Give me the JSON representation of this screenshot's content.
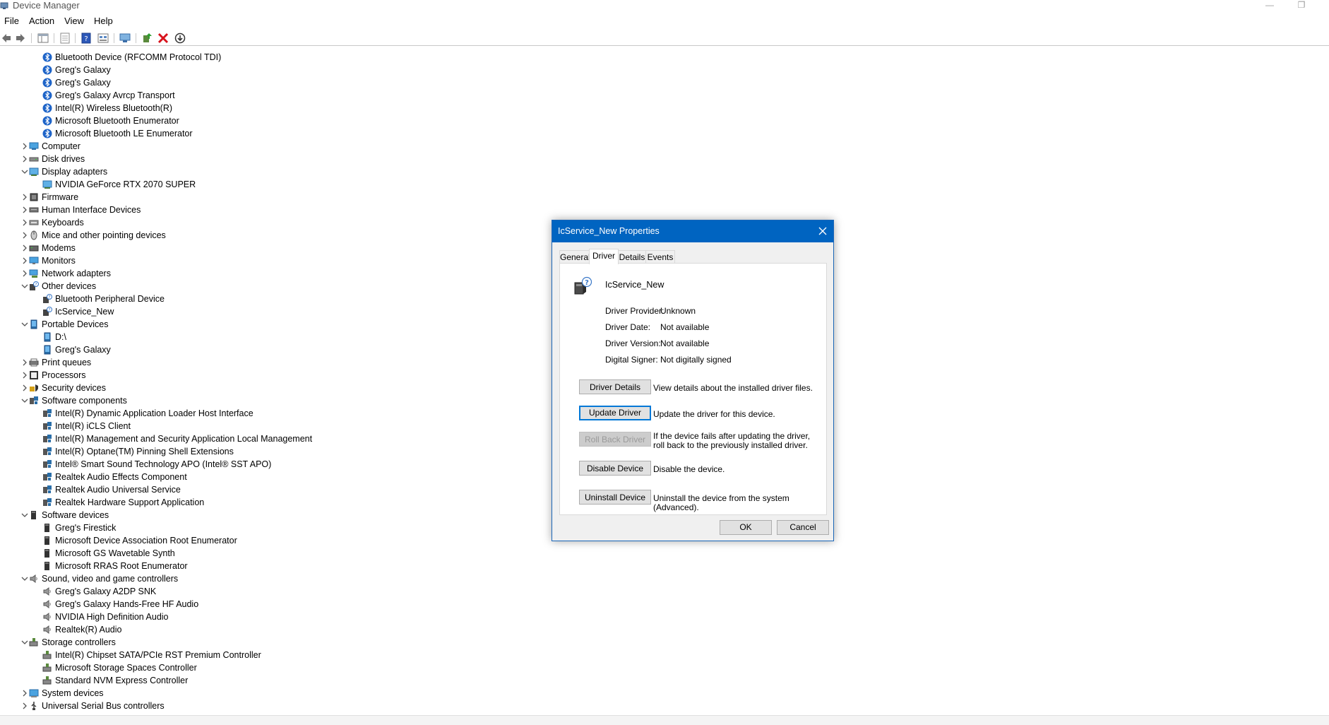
{
  "window": {
    "title": "Device Manager"
  },
  "menu": [
    "File",
    "Action",
    "View",
    "Help"
  ],
  "toolbar": {
    "buttons": [
      "back-arrow-icon",
      "forward-arrow-icon",
      "show-hide-console-tree-icon",
      "properties-icon",
      "help-icon",
      "resource-view-icon",
      "scan-hardware-icon",
      "update-driver-icon",
      "uninstall-device-icon",
      "disable-device-icon"
    ]
  },
  "tree": [
    {
      "label": "Bluetooth Device (RFCOMM Protocol TDI)",
      "level": 1,
      "icon": "bluetooth-icon"
    },
    {
      "label": "Greg's Galaxy",
      "level": 1,
      "icon": "bluetooth-icon"
    },
    {
      "label": "Greg's Galaxy",
      "level": 1,
      "icon": "bluetooth-icon"
    },
    {
      "label": "Greg's Galaxy Avrcp Transport",
      "level": 1,
      "icon": "bluetooth-icon"
    },
    {
      "label": "Intel(R) Wireless Bluetooth(R)",
      "level": 1,
      "icon": "bluetooth-icon"
    },
    {
      "label": "Microsoft Bluetooth Enumerator",
      "level": 1,
      "icon": "bluetooth-icon"
    },
    {
      "label": "Microsoft Bluetooth LE Enumerator",
      "level": 1,
      "icon": "bluetooth-icon"
    },
    {
      "label": "Computer",
      "level": 0,
      "icon": "computer-icon",
      "expanded": false
    },
    {
      "label": "Disk drives",
      "level": 0,
      "icon": "disk-drive-icon",
      "expanded": false
    },
    {
      "label": "Display adapters",
      "level": 0,
      "icon": "display-adapter-icon",
      "expanded": true
    },
    {
      "label": "NVIDIA GeForce RTX 2070 SUPER",
      "level": 1,
      "icon": "display-adapter-icon"
    },
    {
      "label": "Firmware",
      "level": 0,
      "icon": "firmware-icon",
      "expanded": false
    },
    {
      "label": "Human Interface Devices",
      "level": 0,
      "icon": "hid-icon",
      "expanded": false
    },
    {
      "label": "Keyboards",
      "level": 0,
      "icon": "keyboard-icon",
      "expanded": false
    },
    {
      "label": "Mice and other pointing devices",
      "level": 0,
      "icon": "mouse-icon",
      "expanded": false
    },
    {
      "label": "Modems",
      "level": 0,
      "icon": "modem-icon",
      "expanded": false
    },
    {
      "label": "Monitors",
      "level": 0,
      "icon": "monitor-icon",
      "expanded": false
    },
    {
      "label": "Network adapters",
      "level": 0,
      "icon": "network-adapter-icon",
      "expanded": false
    },
    {
      "label": "Other devices",
      "level": 0,
      "icon": "unknown-device-icon",
      "expanded": true
    },
    {
      "label": "Bluetooth Peripheral Device",
      "level": 1,
      "icon": "unknown-device-icon"
    },
    {
      "label": "IcService_New",
      "level": 1,
      "icon": "unknown-device-icon"
    },
    {
      "label": "Portable Devices",
      "level": 0,
      "icon": "portable-device-icon",
      "expanded": true
    },
    {
      "label": "D:\\",
      "level": 1,
      "icon": "portable-device-icon"
    },
    {
      "label": "Greg's Galaxy",
      "level": 1,
      "icon": "portable-device-icon"
    },
    {
      "label": "Print queues",
      "level": 0,
      "icon": "printer-icon",
      "expanded": false
    },
    {
      "label": "Processors",
      "level": 0,
      "icon": "processor-icon",
      "expanded": false
    },
    {
      "label": "Security devices",
      "level": 0,
      "icon": "security-device-icon",
      "expanded": false
    },
    {
      "label": "Software components",
      "level": 0,
      "icon": "software-component-icon",
      "expanded": true
    },
    {
      "label": "Intel(R) Dynamic Application Loader Host Interface",
      "level": 1,
      "icon": "software-component-icon"
    },
    {
      "label": "Intel(R) iCLS Client",
      "level": 1,
      "icon": "software-component-icon"
    },
    {
      "label": "Intel(R) Management and Security Application Local Management",
      "level": 1,
      "icon": "software-component-icon"
    },
    {
      "label": "Intel(R) Optane(TM) Pinning Shell Extensions",
      "level": 1,
      "icon": "software-component-icon"
    },
    {
      "label": "Intel® Smart Sound Technology APO (Intel® SST APO)",
      "level": 1,
      "icon": "software-component-icon"
    },
    {
      "label": "Realtek Audio Effects Component",
      "level": 1,
      "icon": "software-component-icon"
    },
    {
      "label": "Realtek Audio Universal Service",
      "level": 1,
      "icon": "software-component-icon"
    },
    {
      "label": "Realtek Hardware Support Application",
      "level": 1,
      "icon": "software-component-icon"
    },
    {
      "label": "Software devices",
      "level": 0,
      "icon": "software-device-icon",
      "expanded": true
    },
    {
      "label": "Greg's Firestick",
      "level": 1,
      "icon": "software-device-icon"
    },
    {
      "label": "Microsoft Device Association Root Enumerator",
      "level": 1,
      "icon": "software-device-icon"
    },
    {
      "label": "Microsoft GS Wavetable Synth",
      "level": 1,
      "icon": "software-device-icon"
    },
    {
      "label": "Microsoft RRAS Root Enumerator",
      "level": 1,
      "icon": "software-device-icon"
    },
    {
      "label": "Sound, video and game controllers",
      "level": 0,
      "icon": "speaker-icon",
      "expanded": true
    },
    {
      "label": "Greg's Galaxy A2DP SNK",
      "level": 1,
      "icon": "speaker-icon"
    },
    {
      "label": "Greg's Galaxy Hands-Free HF Audio",
      "level": 1,
      "icon": "speaker-icon"
    },
    {
      "label": "NVIDIA High Definition Audio",
      "level": 1,
      "icon": "speaker-icon"
    },
    {
      "label": "Realtek(R) Audio",
      "level": 1,
      "icon": "speaker-icon"
    },
    {
      "label": "Storage controllers",
      "level": 0,
      "icon": "storage-controller-icon",
      "expanded": true
    },
    {
      "label": "Intel(R) Chipset SATA/PCIe RST Premium Controller",
      "level": 1,
      "icon": "storage-controller-icon"
    },
    {
      "label": "Microsoft Storage Spaces Controller",
      "level": 1,
      "icon": "storage-controller-icon"
    },
    {
      "label": "Standard NVM Express Controller",
      "level": 1,
      "icon": "storage-controller-icon"
    },
    {
      "label": "System devices",
      "level": 0,
      "icon": "system-device-icon",
      "expanded": false
    },
    {
      "label": "Universal Serial Bus controllers",
      "level": 0,
      "icon": "usb-icon",
      "expanded": false
    }
  ],
  "dialog": {
    "title": "IcService_New Properties",
    "tabs": [
      "General",
      "Driver",
      "Details",
      "Events"
    ],
    "active_tab": "Driver",
    "device_name": "IcService_New",
    "properties": [
      {
        "label": "Driver Provider:",
        "value": "Unknown"
      },
      {
        "label": "Driver Date:",
        "value": "Not available"
      },
      {
        "label": "Driver Version:",
        "value": "Not available"
      },
      {
        "label": "Digital Signer:",
        "value": "Not digitally signed"
      }
    ],
    "actions": [
      {
        "label": "Driver Details",
        "desc": "View details about the installed driver files.",
        "state": "enabled"
      },
      {
        "label": "Update Driver",
        "desc": "Update the driver for this device.",
        "state": "focused"
      },
      {
        "label": "Roll Back Driver",
        "desc": "If the device fails after updating the driver, roll back to the previously installed driver.",
        "state": "disabled"
      },
      {
        "label": "Disable Device",
        "desc": "Disable the device.",
        "state": "enabled"
      },
      {
        "label": "Uninstall Device",
        "desc": "Uninstall the device from the system (Advanced).",
        "state": "enabled"
      }
    ],
    "ok_label": "OK",
    "cancel_label": "Cancel"
  }
}
